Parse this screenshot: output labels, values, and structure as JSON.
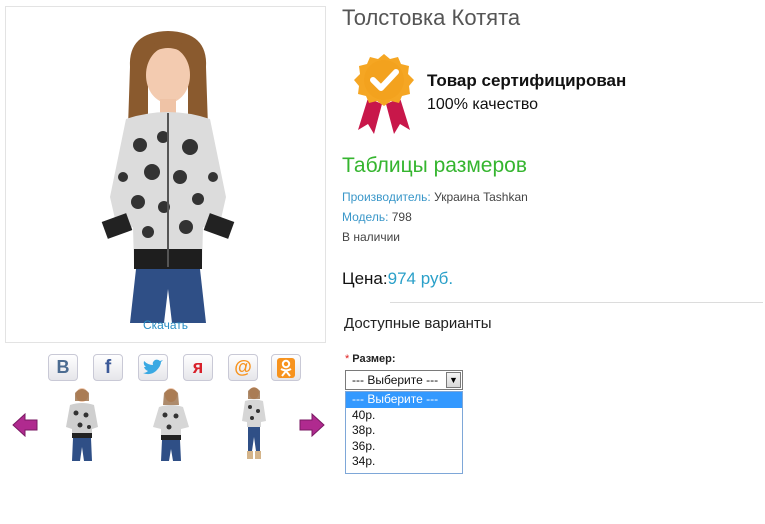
{
  "product": {
    "title": "Толстовка Котята",
    "download": "Скачать"
  },
  "certificate": {
    "title": "Товар сертифицирован",
    "subtitle": "100% качество"
  },
  "size_tables": "Таблицы размеров",
  "meta": {
    "manufacturer_label": "Производитель:",
    "manufacturer_value": "Украина Tashkan",
    "model_label": "Модель:",
    "model_value": "798",
    "availability": "В наличии"
  },
  "price": {
    "label": "Цена:",
    "value": "974 руб."
  },
  "variants": {
    "title": "Доступные варианты",
    "size_label": "Размер:",
    "required_mark": "*",
    "selected": "--- Выберите ---",
    "options": [
      "--- Выберите ---",
      "40р.",
      "38р.",
      "36р.",
      "34р."
    ]
  },
  "social": [
    {
      "name": "vk",
      "glyph": "В",
      "color": "#4c6c91"
    },
    {
      "name": "facebook",
      "glyph": "f",
      "color": "#3b5998"
    },
    {
      "name": "twitter",
      "glyph": "t",
      "color": "#3aa9e3"
    },
    {
      "name": "moi-mir",
      "glyph": "я",
      "color": "#d8202a"
    },
    {
      "name": "mail",
      "glyph": "@",
      "color": "#f7931e"
    },
    {
      "name": "odnoklassniki",
      "glyph": "ок",
      "color": "#f7931e"
    }
  ],
  "colors": {
    "link_blue": "#2a8fc5",
    "accent_green": "#35b52f",
    "price_blue": "#2aa0c9",
    "badge_gold": "#f5a623",
    "ribbon_red": "#c8174a",
    "arrow_purple": "#b02a8f"
  }
}
